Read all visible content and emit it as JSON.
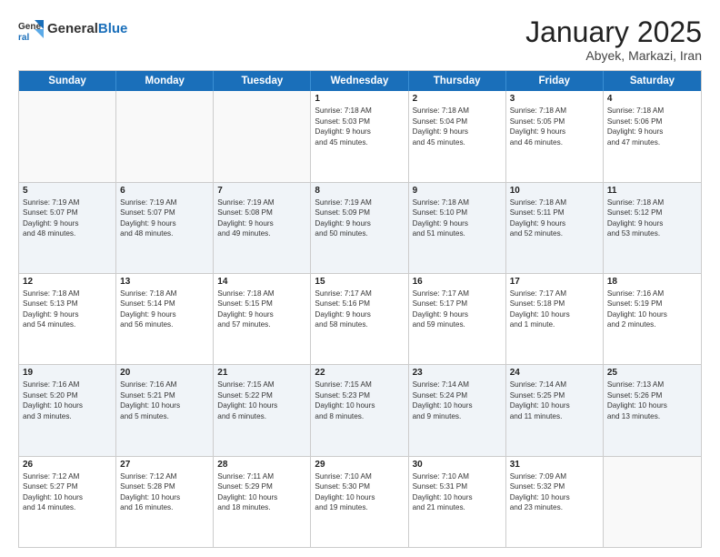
{
  "header": {
    "logo_general": "General",
    "logo_blue": "Blue",
    "month": "January 2025",
    "location": "Abyek, Markazi, Iran"
  },
  "days_of_week": [
    "Sunday",
    "Monday",
    "Tuesday",
    "Wednesday",
    "Thursday",
    "Friday",
    "Saturday"
  ],
  "weeks": [
    [
      {
        "day": "",
        "empty": true
      },
      {
        "day": "",
        "empty": true
      },
      {
        "day": "",
        "empty": true
      },
      {
        "day": "1",
        "line1": "Sunrise: 7:18 AM",
        "line2": "Sunset: 5:03 PM",
        "line3": "Daylight: 9 hours",
        "line4": "and 45 minutes."
      },
      {
        "day": "2",
        "line1": "Sunrise: 7:18 AM",
        "line2": "Sunset: 5:04 PM",
        "line3": "Daylight: 9 hours",
        "line4": "and 45 minutes."
      },
      {
        "day": "3",
        "line1": "Sunrise: 7:18 AM",
        "line2": "Sunset: 5:05 PM",
        "line3": "Daylight: 9 hours",
        "line4": "and 46 minutes."
      },
      {
        "day": "4",
        "line1": "Sunrise: 7:18 AM",
        "line2": "Sunset: 5:06 PM",
        "line3": "Daylight: 9 hours",
        "line4": "and 47 minutes."
      }
    ],
    [
      {
        "day": "5",
        "line1": "Sunrise: 7:19 AM",
        "line2": "Sunset: 5:07 PM",
        "line3": "Daylight: 9 hours",
        "line4": "and 48 minutes."
      },
      {
        "day": "6",
        "line1": "Sunrise: 7:19 AM",
        "line2": "Sunset: 5:07 PM",
        "line3": "Daylight: 9 hours",
        "line4": "and 48 minutes."
      },
      {
        "day": "7",
        "line1": "Sunrise: 7:19 AM",
        "line2": "Sunset: 5:08 PM",
        "line3": "Daylight: 9 hours",
        "line4": "and 49 minutes."
      },
      {
        "day": "8",
        "line1": "Sunrise: 7:19 AM",
        "line2": "Sunset: 5:09 PM",
        "line3": "Daylight: 9 hours",
        "line4": "and 50 minutes."
      },
      {
        "day": "9",
        "line1": "Sunrise: 7:18 AM",
        "line2": "Sunset: 5:10 PM",
        "line3": "Daylight: 9 hours",
        "line4": "and 51 minutes."
      },
      {
        "day": "10",
        "line1": "Sunrise: 7:18 AM",
        "line2": "Sunset: 5:11 PM",
        "line3": "Daylight: 9 hours",
        "line4": "and 52 minutes."
      },
      {
        "day": "11",
        "line1": "Sunrise: 7:18 AM",
        "line2": "Sunset: 5:12 PM",
        "line3": "Daylight: 9 hours",
        "line4": "and 53 minutes."
      }
    ],
    [
      {
        "day": "12",
        "line1": "Sunrise: 7:18 AM",
        "line2": "Sunset: 5:13 PM",
        "line3": "Daylight: 9 hours",
        "line4": "and 54 minutes."
      },
      {
        "day": "13",
        "line1": "Sunrise: 7:18 AM",
        "line2": "Sunset: 5:14 PM",
        "line3": "Daylight: 9 hours",
        "line4": "and 56 minutes."
      },
      {
        "day": "14",
        "line1": "Sunrise: 7:18 AM",
        "line2": "Sunset: 5:15 PM",
        "line3": "Daylight: 9 hours",
        "line4": "and 57 minutes."
      },
      {
        "day": "15",
        "line1": "Sunrise: 7:17 AM",
        "line2": "Sunset: 5:16 PM",
        "line3": "Daylight: 9 hours",
        "line4": "and 58 minutes."
      },
      {
        "day": "16",
        "line1": "Sunrise: 7:17 AM",
        "line2": "Sunset: 5:17 PM",
        "line3": "Daylight: 9 hours",
        "line4": "and 59 minutes."
      },
      {
        "day": "17",
        "line1": "Sunrise: 7:17 AM",
        "line2": "Sunset: 5:18 PM",
        "line3": "Daylight: 10 hours",
        "line4": "and 1 minute."
      },
      {
        "day": "18",
        "line1": "Sunrise: 7:16 AM",
        "line2": "Sunset: 5:19 PM",
        "line3": "Daylight: 10 hours",
        "line4": "and 2 minutes."
      }
    ],
    [
      {
        "day": "19",
        "line1": "Sunrise: 7:16 AM",
        "line2": "Sunset: 5:20 PM",
        "line3": "Daylight: 10 hours",
        "line4": "and 3 minutes."
      },
      {
        "day": "20",
        "line1": "Sunrise: 7:16 AM",
        "line2": "Sunset: 5:21 PM",
        "line3": "Daylight: 10 hours",
        "line4": "and 5 minutes."
      },
      {
        "day": "21",
        "line1": "Sunrise: 7:15 AM",
        "line2": "Sunset: 5:22 PM",
        "line3": "Daylight: 10 hours",
        "line4": "and 6 minutes."
      },
      {
        "day": "22",
        "line1": "Sunrise: 7:15 AM",
        "line2": "Sunset: 5:23 PM",
        "line3": "Daylight: 10 hours",
        "line4": "and 8 minutes."
      },
      {
        "day": "23",
        "line1": "Sunrise: 7:14 AM",
        "line2": "Sunset: 5:24 PM",
        "line3": "Daylight: 10 hours",
        "line4": "and 9 minutes."
      },
      {
        "day": "24",
        "line1": "Sunrise: 7:14 AM",
        "line2": "Sunset: 5:25 PM",
        "line3": "Daylight: 10 hours",
        "line4": "and 11 minutes."
      },
      {
        "day": "25",
        "line1": "Sunrise: 7:13 AM",
        "line2": "Sunset: 5:26 PM",
        "line3": "Daylight: 10 hours",
        "line4": "and 13 minutes."
      }
    ],
    [
      {
        "day": "26",
        "line1": "Sunrise: 7:12 AM",
        "line2": "Sunset: 5:27 PM",
        "line3": "Daylight: 10 hours",
        "line4": "and 14 minutes."
      },
      {
        "day": "27",
        "line1": "Sunrise: 7:12 AM",
        "line2": "Sunset: 5:28 PM",
        "line3": "Daylight: 10 hours",
        "line4": "and 16 minutes."
      },
      {
        "day": "28",
        "line1": "Sunrise: 7:11 AM",
        "line2": "Sunset: 5:29 PM",
        "line3": "Daylight: 10 hours",
        "line4": "and 18 minutes."
      },
      {
        "day": "29",
        "line1": "Sunrise: 7:10 AM",
        "line2": "Sunset: 5:30 PM",
        "line3": "Daylight: 10 hours",
        "line4": "and 19 minutes."
      },
      {
        "day": "30",
        "line1": "Sunrise: 7:10 AM",
        "line2": "Sunset: 5:31 PM",
        "line3": "Daylight: 10 hours",
        "line4": "and 21 minutes."
      },
      {
        "day": "31",
        "line1": "Sunrise: 7:09 AM",
        "line2": "Sunset: 5:32 PM",
        "line3": "Daylight: 10 hours",
        "line4": "and 23 minutes."
      },
      {
        "day": "",
        "empty": true
      }
    ]
  ]
}
